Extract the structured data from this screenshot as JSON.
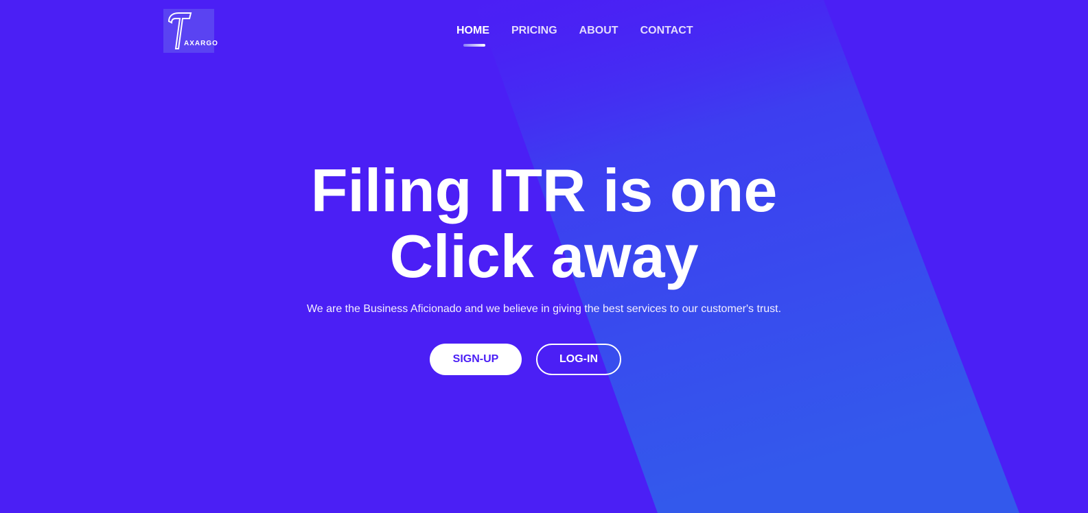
{
  "brand": {
    "logo_text": "AXARGO",
    "logo_letter": "T"
  },
  "nav": {
    "items": [
      {
        "label": "HOME",
        "active": true
      },
      {
        "label": "PRICING",
        "active": false
      },
      {
        "label": "ABOUT",
        "active": false
      },
      {
        "label": "CONTACT",
        "active": false
      }
    ]
  },
  "hero": {
    "headline_line1": "Filing ITR is one",
    "headline_line2": "Click away",
    "subtitle": "We are the Business Aficionado and we believe in giving the best services to our customer's trust."
  },
  "actions": {
    "signup_label": "SIGN-UP",
    "login_label": "LOG-IN"
  },
  "colors": {
    "background": "#4b1ff5",
    "accent_band": "#3359ec",
    "button_text": "#4b1ff5"
  }
}
